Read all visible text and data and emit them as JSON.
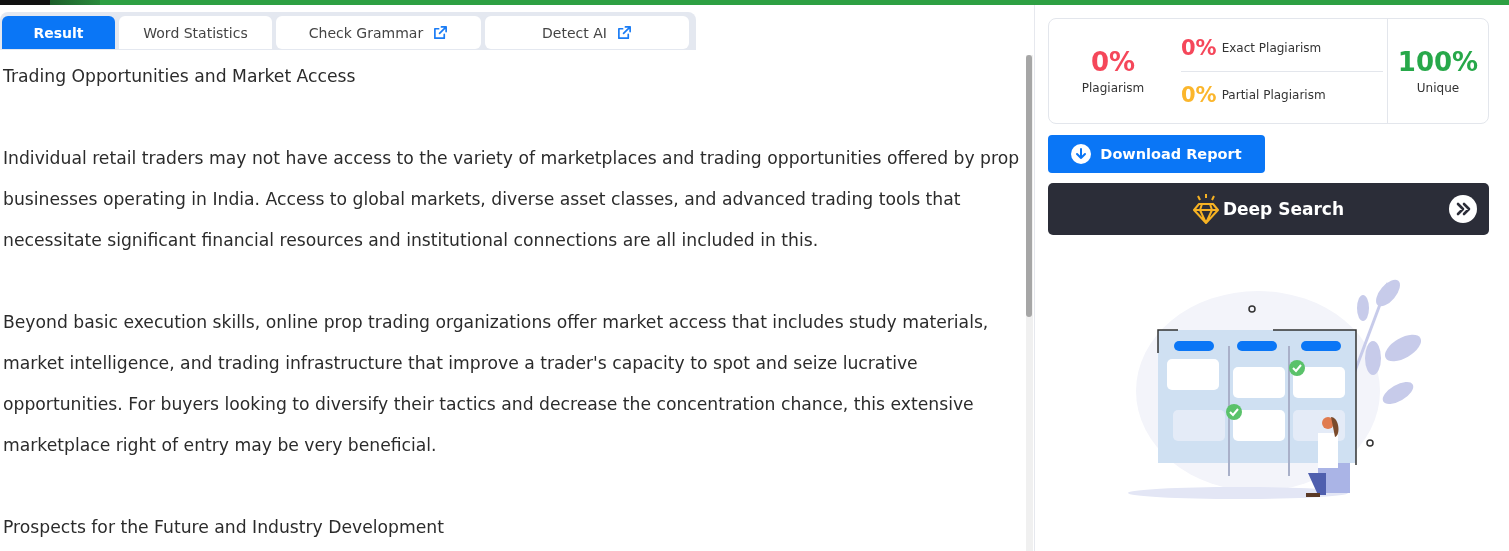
{
  "tabs": [
    {
      "label": "Result",
      "selected": true,
      "external": false
    },
    {
      "label": "Word Statistics",
      "selected": false,
      "external": false
    },
    {
      "label": "Check Grammar",
      "selected": false,
      "external": true
    },
    {
      "label": "Detect AI",
      "selected": false,
      "external": true
    }
  ],
  "document": [
    "Trading Opportunities and Market Access",
    "Individual retail traders may not have access to the variety of marketplaces and trading opportunities offered by prop businesses operating in India. Access to global markets, diverse asset classes, and advanced trading tools that necessitate significant financial resources and institutional connections are all included in this.",
    "Beyond basic execution skills, online prop trading organizations offer market access that includes study materials, market intelligence, and trading infrastructure that improve a trader's capacity to spot and seize lucrative opportunities. For buyers looking to diversify their tactics and decrease the concentration chance, this extensive marketplace right of entry may be very beneficial.",
    "Prospects for the Future and Industry Development"
  ],
  "summary": {
    "plagiarism": {
      "value": "0%",
      "label": "Plagiarism"
    },
    "exact": {
      "value": "0%",
      "label": "Exact Plagiarism"
    },
    "partial": {
      "value": "0%",
      "label": "Partial Plagiarism"
    },
    "unique": {
      "value": "100%",
      "label": "Unique"
    }
  },
  "download_button": "Download Report",
  "deep_search_button": "Deep Search"
}
